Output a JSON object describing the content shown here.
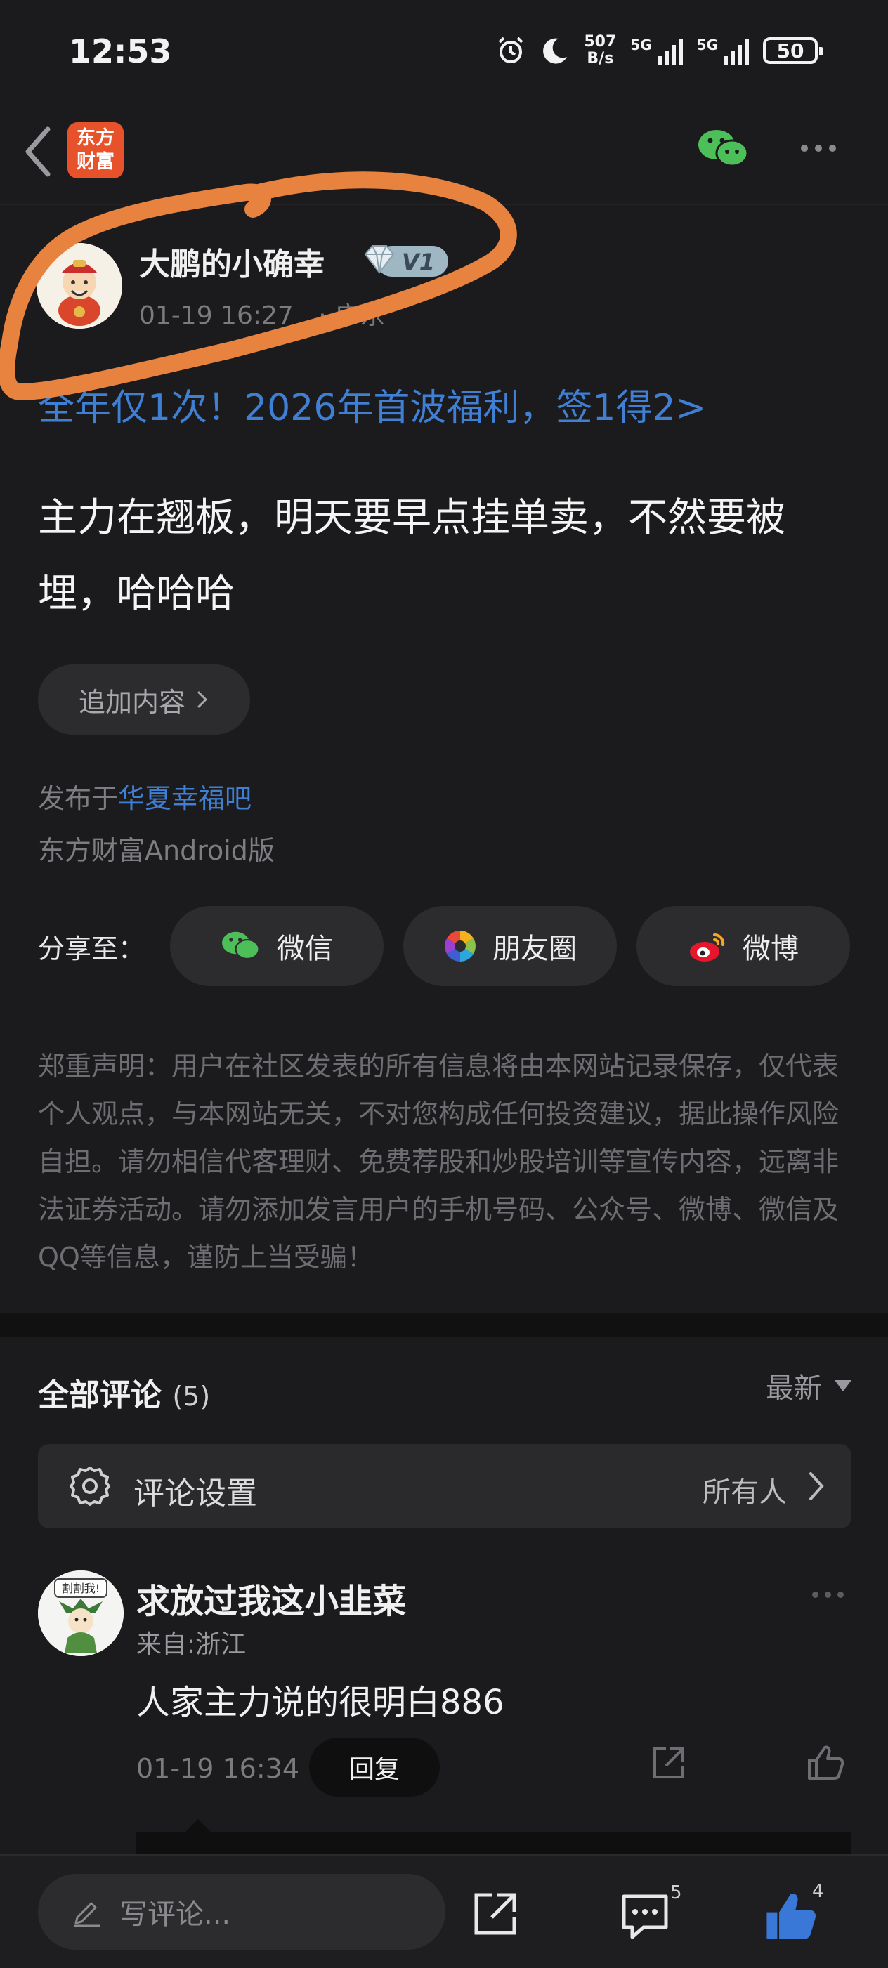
{
  "status_bar": {
    "time": "12:53",
    "net_speed_value": "507",
    "net_speed_unit": "B/s",
    "signal_1": "5G",
    "signal_2": "5G",
    "battery": "50"
  },
  "nav": {
    "app_logo_line1": "东方",
    "app_logo_line2": "财富",
    "back_icon": "chevron-left-icon",
    "share_icon": "wechat-icon",
    "more_icon": "more-dots-icon"
  },
  "post": {
    "author": "大鹏的小确幸",
    "level_badge": "V1",
    "date": "01-19 16:27",
    "location": "· 广东",
    "promo_link": "全年仅1次！2026年首波福利，签1得2>",
    "body": "主力在翘板，明天要早点挂单卖，不然要被埋，哈哈哈",
    "add_content_label": "追加内容",
    "published_prefix": "发布于",
    "published_forum": "华夏幸福吧",
    "platform": "东方财富Android版"
  },
  "share": {
    "label": "分享至：",
    "buttons": [
      {
        "label": "微信",
        "icon": "wechat-icon"
      },
      {
        "label": "朋友圈",
        "icon": "moments-icon"
      },
      {
        "label": "微博",
        "icon": "weibo-icon"
      }
    ]
  },
  "disclaimer": "郑重声明：用户在社区发表的所有信息将由本网站记录保存，仅代表个人观点，与本网站无关，不对您构成任何投资建议，据此操作风险自担。请勿相信代客理财、免费荐股和炒股培训等宣传内容，远离非法证券活动。请勿添加发言用户的手机号码、公众号、微博、微信及QQ等信息，谨防上当受骗！",
  "comments": {
    "title": "全部评论",
    "count": "(5)",
    "sort_label": "最新",
    "settings_label": "评论设置",
    "settings_value": "所有人",
    "items": [
      {
        "name": "求放过我这小韭菜",
        "location": "来自:浙江",
        "text": "人家主力说的很明白886",
        "time": "01-19 16:34",
        "reply_label": "回复"
      }
    ]
  },
  "bottom_bar": {
    "write_placeholder": "写评论...",
    "comment_count": "5",
    "like_count": "4"
  }
}
